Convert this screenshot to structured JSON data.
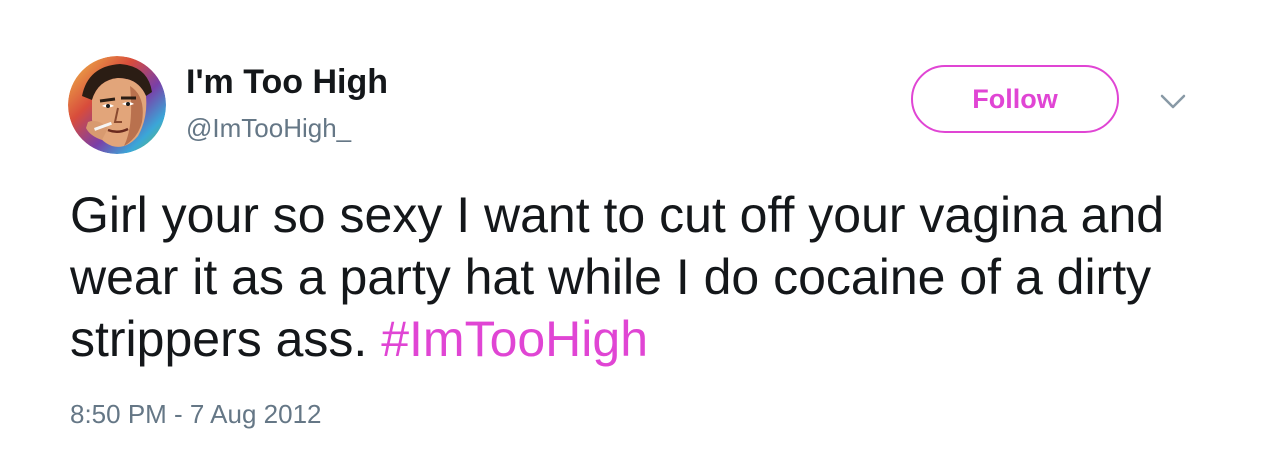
{
  "user": {
    "display_name": "I'm Too High",
    "handle": "@ImTooHigh_",
    "avatar_icon": "profile-avatar"
  },
  "actions": {
    "follow_label": "Follow",
    "menu_icon": "chevron-down-icon"
  },
  "tweet": {
    "text_before_hashtag": "Girl your so sexy I want to cut off your vagina and wear it as a party hat while I do cocaine of a dirty strippers ass. ",
    "hashtag": "#ImTooHigh",
    "timestamp": "8:50 PM - 7 Aug 2012"
  },
  "colors": {
    "accent": "#e045d4",
    "text": "#14171a",
    "muted": "#657786"
  }
}
